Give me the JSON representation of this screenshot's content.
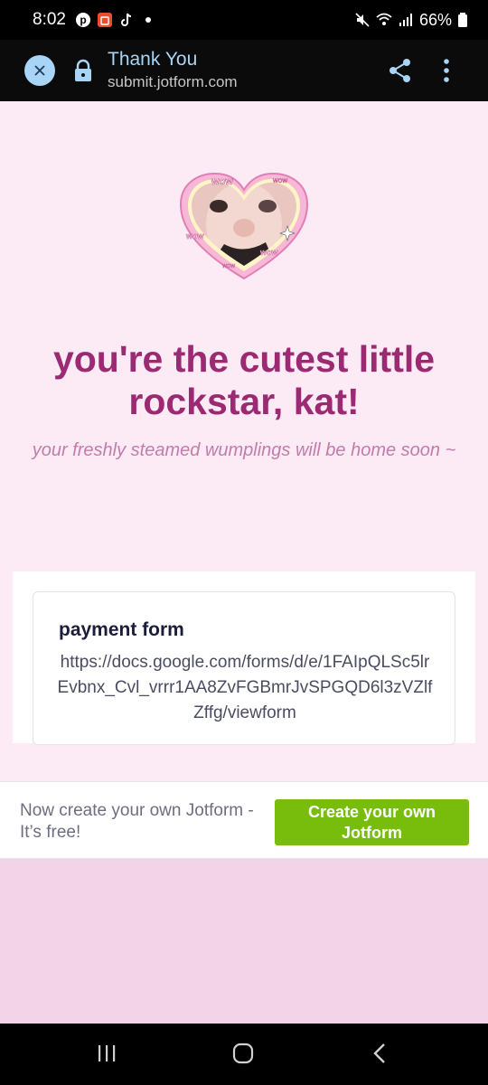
{
  "status_bar": {
    "time": "8:02",
    "battery": "66%",
    "left_icons": [
      "pinterest-icon",
      "shopee-icon",
      "tiktok-icon",
      "dot-icon"
    ],
    "right_icons": [
      "mute-icon",
      "wifi-icon",
      "signal-icon",
      "battery-icon"
    ]
  },
  "toolbar": {
    "title": "Thank You",
    "url": "submit.jotform.com"
  },
  "page": {
    "headline": "you're the cutest little rockstar, kat!",
    "subline": "your freshly steamed wumplings will be home soon ~",
    "heart_sticker_text": "wow"
  },
  "card": {
    "title": "payment form",
    "link": "https://docs.google.com/forms/d/e/1FAIpQLSc5lrEvbnx_Cvl_vrrr1AA8ZvFGBmrJvSPGQD6l3zVZlfZffg/viewform"
  },
  "promo": {
    "text": "Now create your own Jotform - It’s free!",
    "button": "Create your own Jotform"
  },
  "colors": {
    "headline": "#9b2a72",
    "subline": "#c27cac",
    "page_bg": "#fceaf5",
    "button": "#78bd0b",
    "toolbar_accent": "#a8d4f5"
  }
}
